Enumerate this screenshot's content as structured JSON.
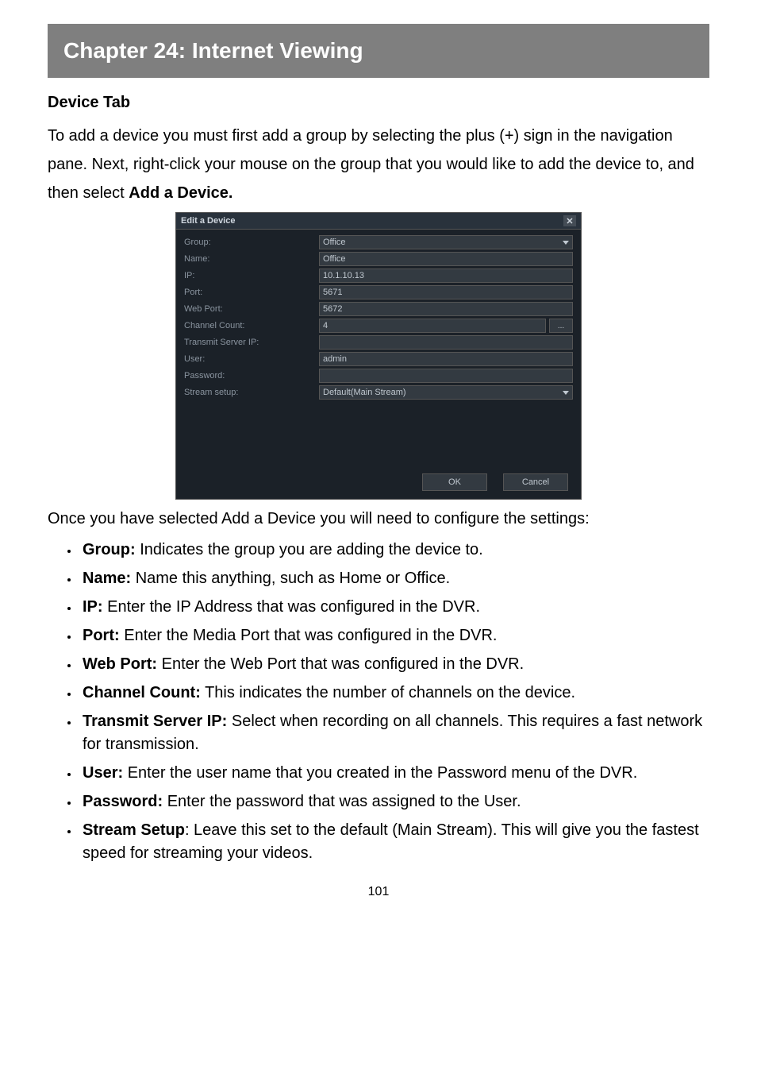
{
  "chapter_title": "Chapter 24: Internet Viewing",
  "subhead": "Device Tab",
  "intro": {
    "pre": "To add a device you must first add a group by selecting the plus (+) sign in the navigation pane. Next, right-click your mouse on the group that you would like to add the device to, and then select ",
    "bold": "Add a Device."
  },
  "dialog": {
    "title": "Edit a Device",
    "close": "✕",
    "fields": {
      "group_label": "Group:",
      "group_value": "Office",
      "name_label": "Name:",
      "name_value": "Office",
      "ip_label": "IP:",
      "ip_value": "10.1.10.13",
      "port_label": "Port:",
      "port_value": "5671",
      "web_label": "Web Port:",
      "web_value": "5672",
      "channel_label": "Channel Count:",
      "channel_value": "4",
      "channel_button": "...",
      "transmit_label": "Transmit Server IP:",
      "transmit_value": "",
      "user_label": "User:",
      "user_value": "admin",
      "password_label": "Password:",
      "password_value": "",
      "stream_label": "Stream setup:",
      "stream_value": "Default(Main Stream)"
    },
    "buttons": {
      "ok": "OK",
      "cancel": "Cancel"
    }
  },
  "post_dialog": "Once you have selected Add a Device you will need to configure the settings:",
  "items": [
    {
      "lead": "Group:",
      "rest": " Indicates the group you are adding the device to."
    },
    {
      "lead": "Name:",
      "rest": " Name this anything, such as Home or Office."
    },
    {
      "lead": "IP:",
      "rest": " Enter the IP Address that was configured in the DVR."
    },
    {
      "lead": "Port:",
      "rest": " Enter the Media Port that was configured in the DVR."
    },
    {
      "lead": "Web Port:",
      "rest": " Enter the Web Port that was configured in the DVR."
    },
    {
      "lead": "Channel Count:",
      "rest": " This indicates the number of channels on the device."
    },
    {
      "lead": "Transmit Server IP:",
      "rest": " Select when recording on all channels. This requires a fast network for transmission."
    },
    {
      "lead": "User:",
      "rest": " Enter the user name that you created in the Password menu of the DVR."
    },
    {
      "lead": "Password:",
      "rest": " Enter the password that was assigned to the User."
    },
    {
      "lead": "Stream Setup",
      "rest": ": Leave this set to the default (Main Stream). This will give you the fastest speed for streaming your videos."
    }
  ],
  "page_number": "101"
}
